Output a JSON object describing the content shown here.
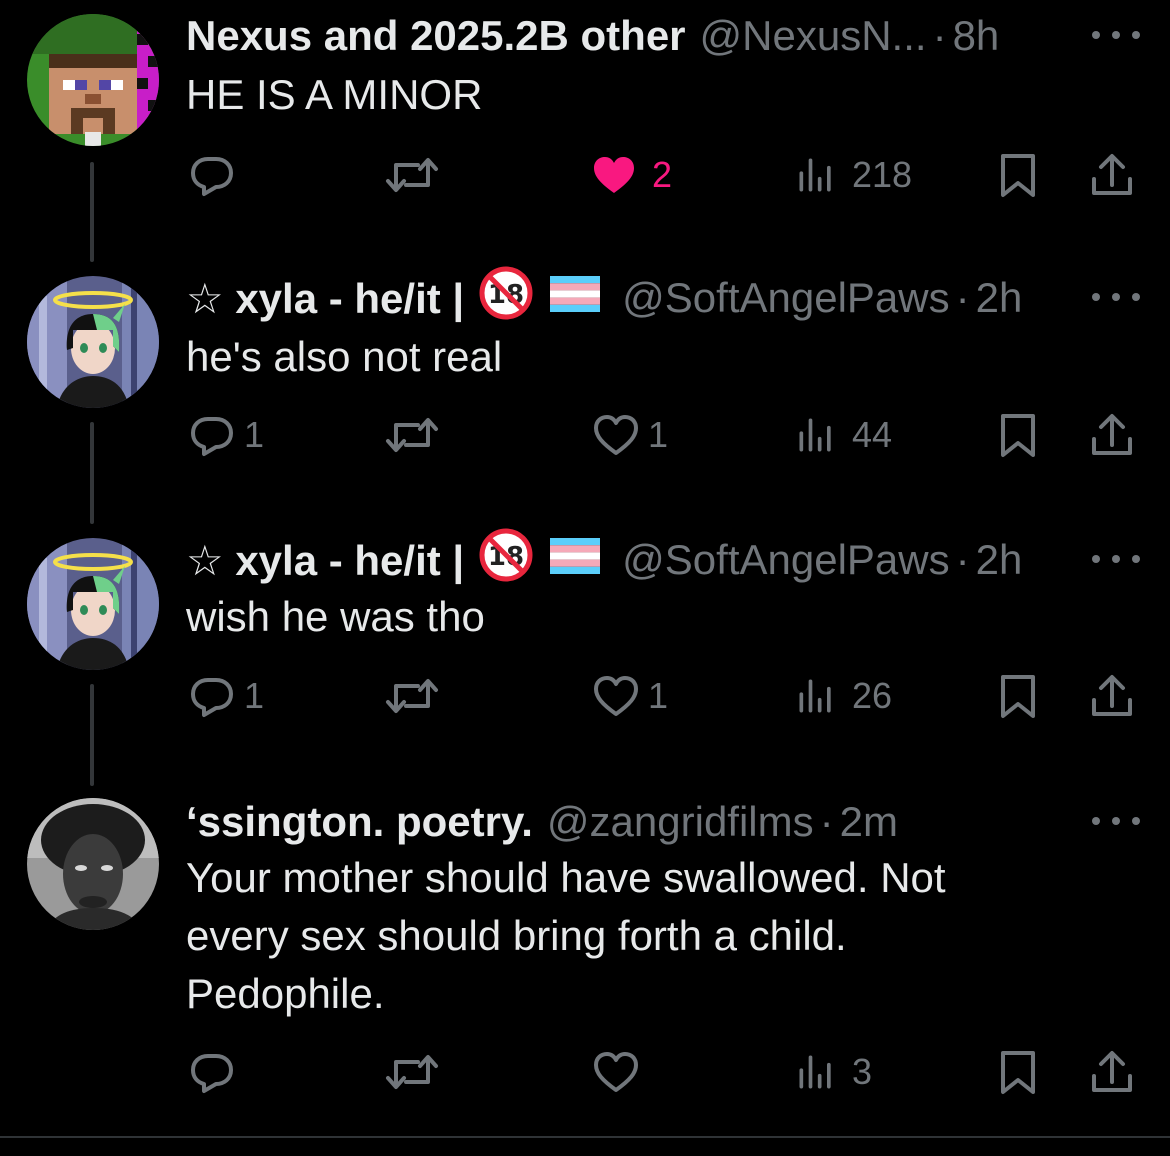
{
  "colors": {
    "background": "#000000",
    "primary_text": "#e7e9ea",
    "secondary_text": "#71767b",
    "like_active": "#f91880",
    "thread_line": "#333639"
  },
  "tweets": [
    {
      "name": "Nexus and 2025.2B other",
      "handle": "@NexusN...",
      "separator": "·",
      "time": "8h",
      "text": "HE IS A MINOR",
      "replies": "",
      "reposts": "",
      "likes": "2",
      "liked": true,
      "views": "218",
      "avatar": "minecraft-steve-avatar"
    },
    {
      "name": "☆ xyla - he/it |",
      "handle": "@SoftAngelPaws",
      "separator": "·",
      "time": "2h",
      "text": "he's also not real",
      "replies": "1",
      "reposts": "",
      "likes": "1",
      "liked": false,
      "views": "44",
      "avatar": "anime-halo-avatar"
    },
    {
      "name": "☆ xyla - he/it |",
      "handle": "@SoftAngelPaws",
      "separator": "·",
      "time": "2h",
      "text": "wish he was tho",
      "replies": "1",
      "reposts": "",
      "likes": "1",
      "liked": false,
      "views": "26",
      "avatar": "anime-halo-avatar"
    },
    {
      "name": "‘ssington. poetry.",
      "handle": "@zangridfilms",
      "separator": "·",
      "time": "2m",
      "text": "Your mother should have swallowed. Not\nevery sex should bring forth a child.\nPedophile.",
      "replies": "",
      "reposts": "",
      "likes": "",
      "liked": false,
      "views": "3",
      "avatar": "grayscale-photo-avatar"
    }
  ],
  "badges": {
    "no_under_18": "18",
    "flag": "trans-flag"
  },
  "icons": [
    "reply-icon",
    "repost-icon",
    "like-icon",
    "views-icon",
    "bookmark-icon",
    "share-icon",
    "more-icon"
  ]
}
